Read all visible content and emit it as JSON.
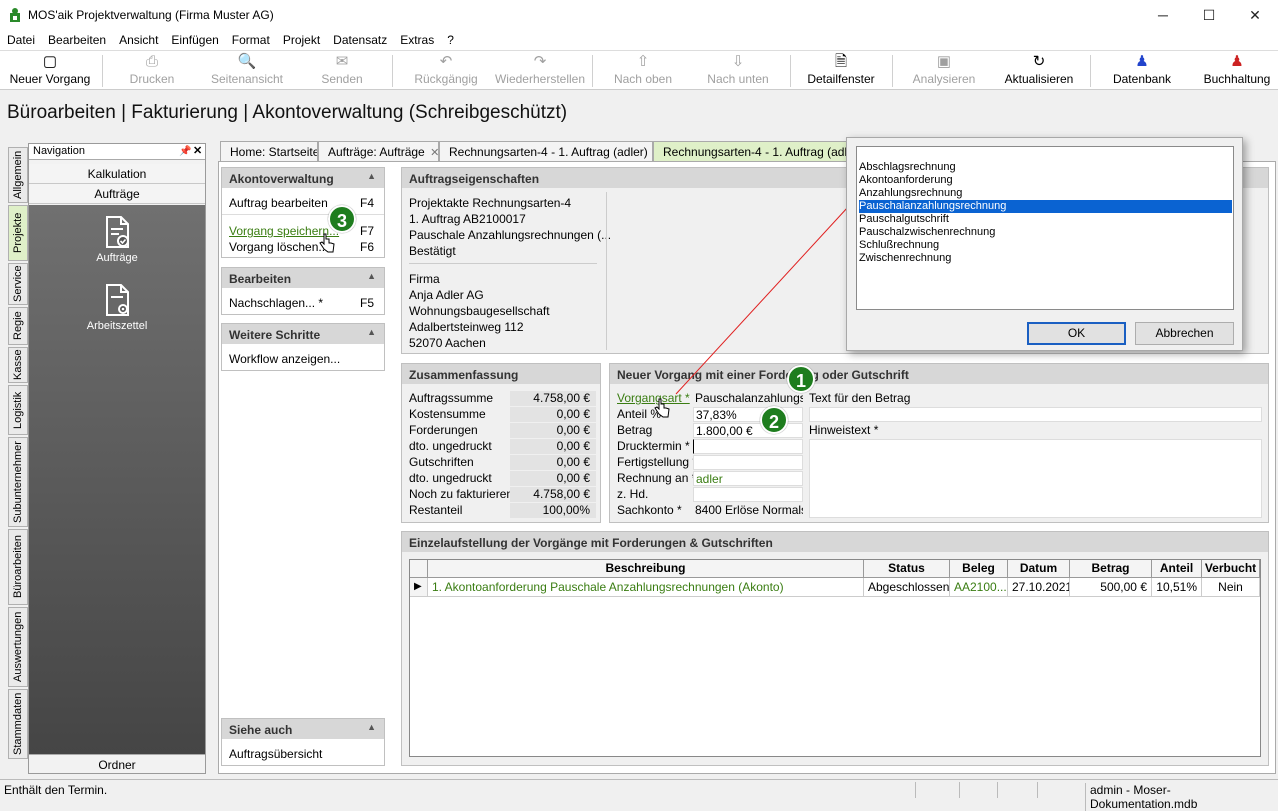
{
  "window": {
    "title": "MOS'aik Projektverwaltung (Firma Muster AG)",
    "min": "─",
    "max": "☐",
    "close": "✕"
  },
  "menu": [
    "Datei",
    "Bearbeiten",
    "Ansicht",
    "Einfügen",
    "Format",
    "Projekt",
    "Datensatz",
    "Extras",
    "?"
  ],
  "toolbar": {
    "new": {
      "label": "Neuer Vorgang",
      "icon": "▢"
    },
    "print": {
      "label": "Drucken",
      "icon": "⎙"
    },
    "pageview": {
      "label": "Seitenansicht",
      "icon": "🔍"
    },
    "send": {
      "label": "Senden",
      "icon": "✉"
    },
    "undo": {
      "label": "Rückgängig",
      "icon": "↶"
    },
    "redo": {
      "label": "Wiederherstellen",
      "icon": "↷"
    },
    "up": {
      "label": "Nach oben",
      "icon": "⇧"
    },
    "down": {
      "label": "Nach unten",
      "icon": "⇩"
    },
    "detail": {
      "label": "Detailfenster",
      "icon": "🗎"
    },
    "analyze": {
      "label": "Analysieren",
      "icon": "▣"
    },
    "refresh": {
      "label": "Aktualisieren",
      "icon": "↻"
    },
    "db": {
      "label": "Datenbank",
      "icon": "♟"
    },
    "accounting": {
      "label": "Buchhaltung",
      "icon": "♟"
    }
  },
  "page_title": "Büroarbeiten | Fakturierung | Akontoverwaltung (Schreibgeschützt)",
  "vtabs": [
    "Allgemein",
    "Projekte",
    "Service",
    "Regie",
    "Kasse",
    "Logistik",
    "Subunternehmer",
    "Büroarbeiten",
    "Auswertungen",
    "Stammdaten"
  ],
  "nav": {
    "title": "Navigation",
    "pin": "📌",
    "close": "✕",
    "kalkulation": "Kalkulation",
    "auftraege": "Aufträge",
    "item1": "Aufträge",
    "item2": "Arbeitszettel",
    "footer": "Ordner"
  },
  "tabs": [
    {
      "label": "Home: Startseite",
      "close": ""
    },
    {
      "label": "Aufträge: Aufträge",
      "close": "✕"
    },
    {
      "label": "Rechnungsarten-4 - 1. Auftrag (adler)",
      "close": "✕"
    },
    {
      "label": "Rechnungsarten-4 - 1. Auftrag (adler)",
      "close": ""
    }
  ],
  "tasks": {
    "akonto": {
      "title": "Akontoverwaltung",
      "items": [
        {
          "label": "Auftrag bearbeiten",
          "key": "F4"
        },
        {
          "label": "Vorgang speichern...",
          "key": "F7"
        },
        {
          "label": "Vorgang löschen...",
          "key": "F6"
        }
      ]
    },
    "edit": {
      "title": "Bearbeiten",
      "items": [
        {
          "label": "Nachschlagen...  *",
          "key": "F5"
        }
      ]
    },
    "next": {
      "title": "Weitere Schritte",
      "items": [
        {
          "label": "Workflow anzeigen..."
        }
      ]
    },
    "see": {
      "title": "Siehe auch",
      "items": [
        {
          "label": "Auftragsübersicht"
        }
      ]
    }
  },
  "props": {
    "title": "Auftragseigenschaften",
    "lines1": [
      "Projektakte Rechnungsarten-4",
      "1. Auftrag AB2100017",
      "Pauschale Anzahlungsrechnungen (...",
      "Bestätigt"
    ],
    "lines2": [
      "Firma",
      "Anja Adler AG",
      "Wohnungsbaugesellschaft",
      "Adalbertsteinweg 112",
      "52070 Aachen"
    ]
  },
  "summary": {
    "title": "Zusammenfassung",
    "rows": [
      {
        "label": "Auftragssumme",
        "value": "4.758,00 €"
      },
      {
        "label": "Kostensumme",
        "value": "0,00 €"
      },
      {
        "label": "Forderungen",
        "value": "0,00 €"
      },
      {
        "label": "dto. ungedruckt",
        "value": "0,00 €"
      },
      {
        "label": "Gutschriften",
        "value": "0,00 €"
      },
      {
        "label": "dto. ungedruckt",
        "value": "0,00 €"
      },
      {
        "label": "Noch zu fakturieren",
        "value": "4.758,00 €"
      },
      {
        "label": "Restanteil",
        "value": "100,00%"
      }
    ]
  },
  "newproc": {
    "title": "Neuer Vorgang mit einer Forderung oder Gutschrift",
    "fields": [
      {
        "label": "Vorgangsart *",
        "value": "Pauschalanzahlungsre"
      },
      {
        "label": "Anteil %",
        "value": "37,83%"
      },
      {
        "label": "Betrag",
        "value": "1.800,00 €"
      },
      {
        "label": "Drucktermin *",
        "value": ""
      },
      {
        "label": "Fertigstellung *",
        "value": ""
      },
      {
        "label": "Rechnung an *",
        "value": "adler"
      },
      {
        "label": "z. Hd.",
        "value": ""
      },
      {
        "label": "Sachkonto *",
        "value": "8400 Erlöse Normalste"
      }
    ],
    "text_label": "Text für den Betrag",
    "hint_label": "Hinweistext *"
  },
  "detail": {
    "title": "Einzelaufstellung der Vorgänge mit Forderungen & Gutschriften",
    "columns": [
      "Beschreibung",
      "Status",
      "Beleg",
      "Datum",
      "Betrag",
      "Anteil",
      "Verbucht"
    ],
    "rows": [
      {
        "marker": "▶",
        "desc": "1. Akontoanforderung Pauschale Anzahlungsrechnungen (Akonto)",
        "status": "Abgeschlossen",
        "beleg": "AA2100...",
        "datum": "27.10.2021",
        "betrag": "500,00 €",
        "anteil": "10,51%",
        "verbucht": "Nein"
      }
    ]
  },
  "dialog": {
    "options": [
      "Abschlagsrechnung",
      "Akontoanforderung",
      "Anzahlungsrechnung",
      "Pauschalanzahlungsrechnung",
      "Pauschalgutschrift",
      "Pauschalzwischenrechnung",
      "Schlußrechnung",
      "Zwischenrechnung"
    ],
    "selected_index": 3,
    "ok": "OK",
    "cancel": "Abbrechen"
  },
  "badges": [
    "1",
    "2",
    "3"
  ],
  "status": {
    "left": "Enthält den Termin.",
    "right": "admin - Moser-Dokumentation.mdb"
  },
  "colors": {
    "accent_green": "#1e7d1e",
    "selection": "#0a63d2",
    "active_tab": "#dff0c8"
  }
}
